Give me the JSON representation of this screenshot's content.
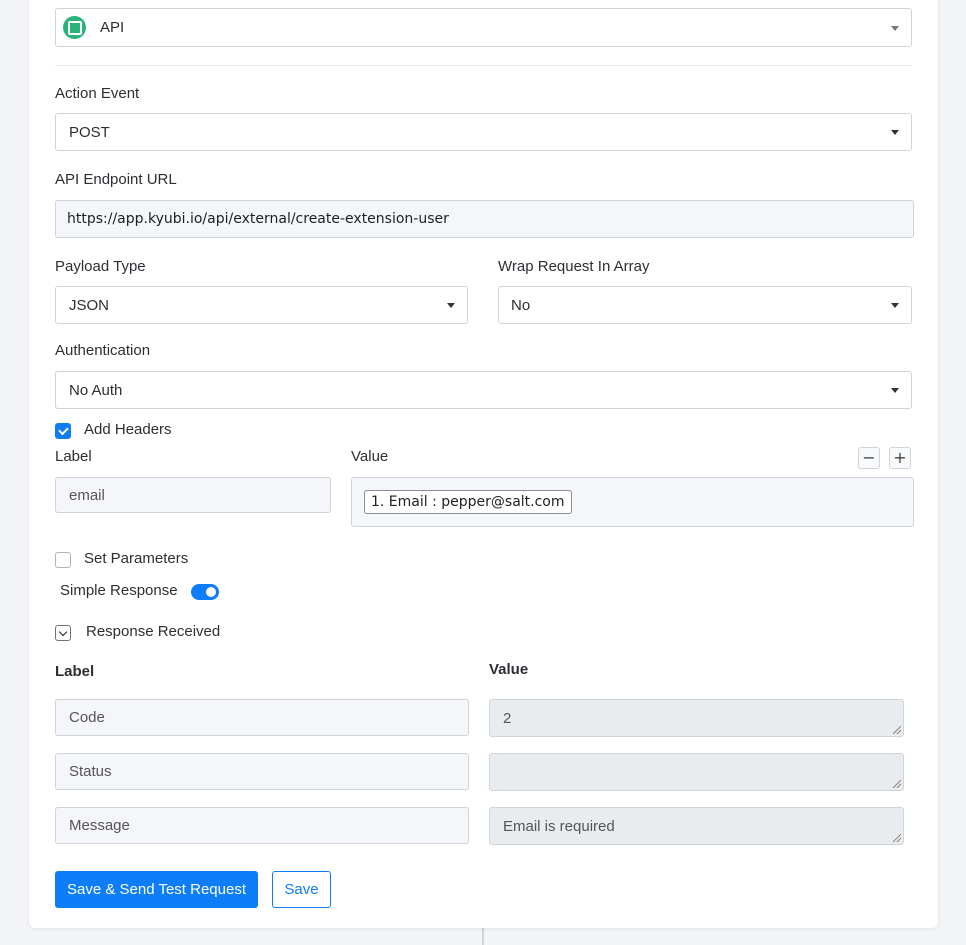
{
  "app_select": {
    "value": "API",
    "icon": "api-app-icon"
  },
  "action_event": {
    "label": "Action Event",
    "value": "POST"
  },
  "endpoint": {
    "label": "API Endpoint URL",
    "value": "https://app.kyubi.io/api/external/create-extension-user"
  },
  "payload_type": {
    "label": "Payload Type",
    "value": "JSON"
  },
  "wrap_request": {
    "label": "Wrap Request In Array",
    "value": "No"
  },
  "authentication": {
    "label": "Authentication",
    "value": "No Auth"
  },
  "headers": {
    "checkbox_label": "Add Headers",
    "checked": true,
    "label_col": "Label",
    "value_col": "Value",
    "rows": [
      {
        "label": "email",
        "value_tag": "1. Email : pepper@salt.com"
      }
    ],
    "remove": "−",
    "add": "+"
  },
  "set_parameters": {
    "label": "Set Parameters",
    "checked": false
  },
  "simple_response": {
    "label": "Simple Response",
    "on": true
  },
  "response_received": {
    "label": "Response Received",
    "label_col": "Label",
    "value_col": "Value",
    "rows": [
      {
        "label": "Code",
        "value": "2"
      },
      {
        "label": "Status",
        "value": ""
      },
      {
        "label": "Message",
        "value": "Email is required"
      }
    ]
  },
  "buttons": {
    "save_send": "Save & Send Test Request",
    "save": "Save"
  },
  "colors": {
    "primary": "#0d7ef7",
    "app_icon": "#29b27a"
  }
}
